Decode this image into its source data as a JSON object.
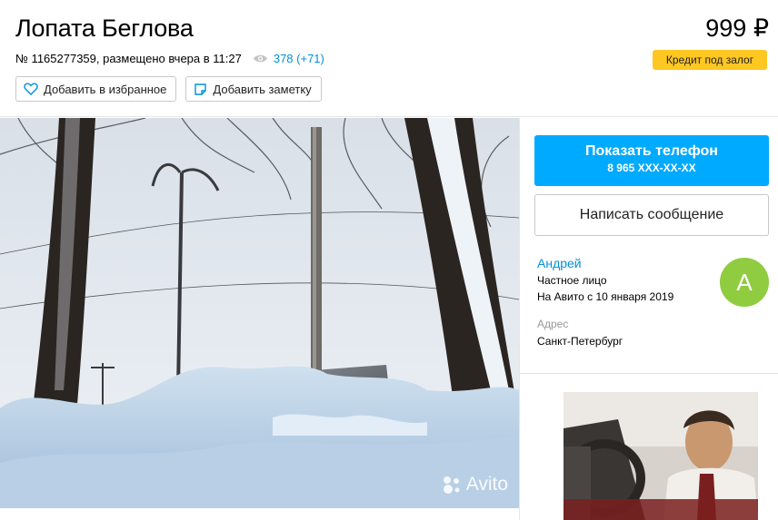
{
  "listing": {
    "title": "Лопата Беглова",
    "price": "999 ₽",
    "meta_text": "№ 1165277359, размещено вчера в 11:27",
    "views": "378 (+71)",
    "credit_label": "Кредит под залог"
  },
  "actions": {
    "favorite_label": "Добавить в избранное",
    "note_label": "Добавить заметку"
  },
  "photo": {
    "watermark": "Avito"
  },
  "contact": {
    "show_phone_label": "Показать телефон",
    "phone_masked": "8 965 XXX-XX-XX",
    "message_label": "Написать сообщение"
  },
  "seller": {
    "name": "Андрей",
    "type": "Частное лицо",
    "since": "На Авито с 10 января 2019",
    "avatar_letter": "А",
    "address_label": "Адрес",
    "address": "Санкт-Петербург"
  },
  "colors": {
    "accent_blue": "#00aaff",
    "link_blue": "#0091d9",
    "credit_yellow": "#fec722",
    "avatar_green": "#8fcc3f"
  }
}
